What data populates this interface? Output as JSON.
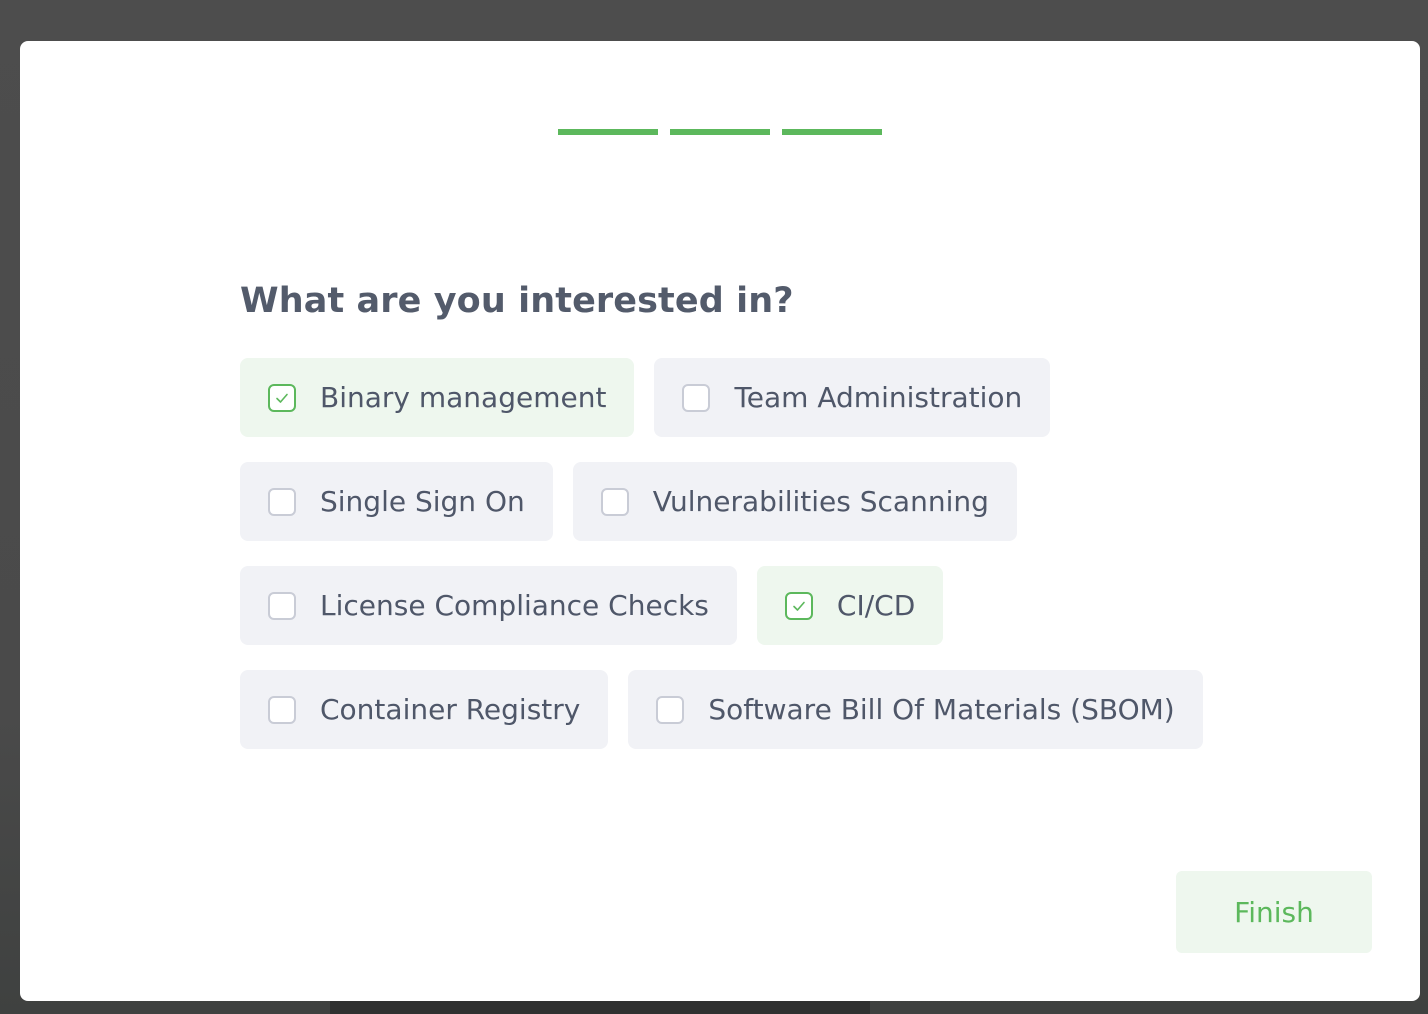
{
  "progress": {
    "total_steps": 3,
    "completed_steps": 3,
    "color": "#5cb85c"
  },
  "question": "What are you interested in?",
  "options": [
    {
      "label": "Binary management",
      "checked": true
    },
    {
      "label": "Team Administration",
      "checked": false
    },
    {
      "label": "Single Sign On",
      "checked": false
    },
    {
      "label": "Vulnerabilities Scanning",
      "checked": false
    },
    {
      "label": "License Compliance Checks",
      "checked": false
    },
    {
      "label": "CI/CD",
      "checked": true
    },
    {
      "label": "Container Registry",
      "checked": false
    },
    {
      "label": "Software Bill Of Materials (SBOM)",
      "checked": false
    }
  ],
  "finish_label": "Finish",
  "colors": {
    "accent": "#5cb85c",
    "option_bg": "#f1f2f6",
    "option_checked_bg": "#eef7ee",
    "text": "#4f5769"
  }
}
